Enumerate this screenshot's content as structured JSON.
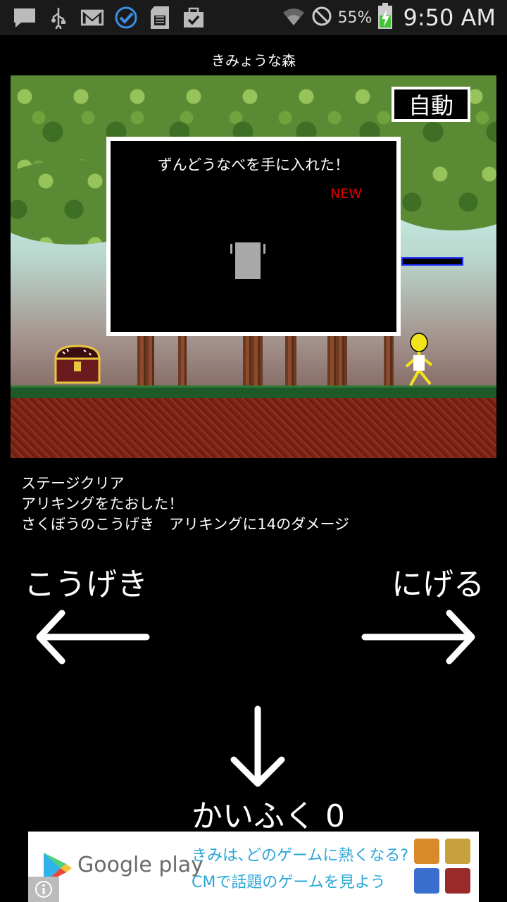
{
  "status_bar": {
    "battery_percent": "55%",
    "time": "9:50 AM",
    "left_icons": [
      "chat-icon",
      "usb-icon",
      "gmail-icon",
      "sync-check-icon",
      "sd-card-icon",
      "clipboard-check-icon"
    ],
    "right_icons": [
      "wifi-icon",
      "no-signal-icon",
      "battery-charging-icon"
    ]
  },
  "game": {
    "stage_title": "きみょうな森",
    "auto_button_label": "自動",
    "dialog": {
      "message": "ずんどうなべを手に入れた！",
      "badge": "NEW",
      "item_icon": "pot-icon"
    },
    "enemy_hp_fraction": 0
  },
  "battle_log": [
    "ステージクリア",
    "アリキングをたおした！",
    "さくぼうのこうげき　アリキングに14のダメージ"
  ],
  "controls": {
    "attack_label": "こうげき",
    "escape_label": "にげる",
    "heal_label": "かいふく 0"
  },
  "ad": {
    "brand": "Google play",
    "line1": "きみは､どのゲームに熱くなる?",
    "line2": "CMで話題のゲームを見よう"
  },
  "colors": {
    "new_badge": "#e00000",
    "hp_border": "#1a2aff",
    "ad_text": "#2aa6d8"
  }
}
